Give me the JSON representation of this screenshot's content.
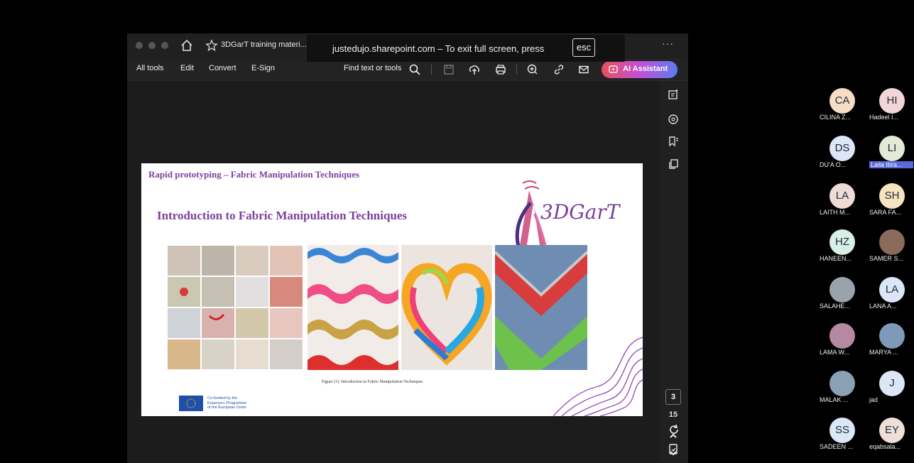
{
  "browser": {
    "tab_title": "3DGarT training materi...",
    "more": "···",
    "fullscreen_notice": "justedujo.sharepoint.com – To exit full screen, press",
    "fullscreen_key": "esc"
  },
  "toolbar": {
    "all_tools": "All tools",
    "edit": "Edit",
    "convert": "Convert",
    "esign": "E-Sign",
    "find": "Find text or tools",
    "ai_assistant": "AI Assistant"
  },
  "pager": {
    "current": "3",
    "total": "15"
  },
  "slide": {
    "header": "Rapid prototyping – Fabric Manipulation Techniques",
    "title": "Introduction to Fabric Manipulation Techniques",
    "logo_text": "3DGarT",
    "caption": "Figure (1): Introduction to Fabric Manipulation Techniques",
    "eu_text": "Co-funded by the\nErasmus+ Programme\nof the European Union"
  },
  "participants": [
    {
      "initials": "CA",
      "name": "CILINA Z...",
      "color": "#f6ddc4"
    },
    {
      "initials": "HI",
      "name": "Hadeel I...",
      "color": "#f2d5d8"
    },
    {
      "initials": "DS",
      "name": "DU'A O...",
      "color": "#dbe6f7"
    },
    {
      "initials": "LI",
      "name": "Laila Ibra...",
      "color": "#e3ead5"
    },
    {
      "initials": "LA",
      "name": "LAITH M...",
      "color": "#efdcd6"
    },
    {
      "initials": "SH",
      "name": "SARA FA...",
      "color": "#f6e3bf"
    },
    {
      "initials": "HZ",
      "name": "HANEEN...",
      "color": "#d7efe6"
    },
    {
      "initials": "",
      "name": "SAMER S...",
      "color": "#8a6a5a"
    },
    {
      "initials": "",
      "name": "SALAHE...",
      "color": "#9aa2ac"
    },
    {
      "initials": "LA",
      "name": "LANA A...",
      "color": "#dbe6f7"
    },
    {
      "initials": "",
      "name": "LAMA W...",
      "color": "#b48aa0"
    },
    {
      "initials": "",
      "name": "MARYA ...",
      "color": "#7d9ab8"
    },
    {
      "initials": "",
      "name": "MALAK ...",
      "color": "#8aa0b4"
    },
    {
      "initials": "J",
      "name": "jad",
      "color": "#dbe6f7"
    },
    {
      "initials": "SS",
      "name": "SADEEN ...",
      "color": "#dbe6f7"
    },
    {
      "initials": "EY",
      "name": "eqabsala...",
      "color": "#eedfd8"
    }
  ],
  "colors": {
    "accent_purple": "#7b3f9e",
    "highlight": "#5a67d8"
  }
}
